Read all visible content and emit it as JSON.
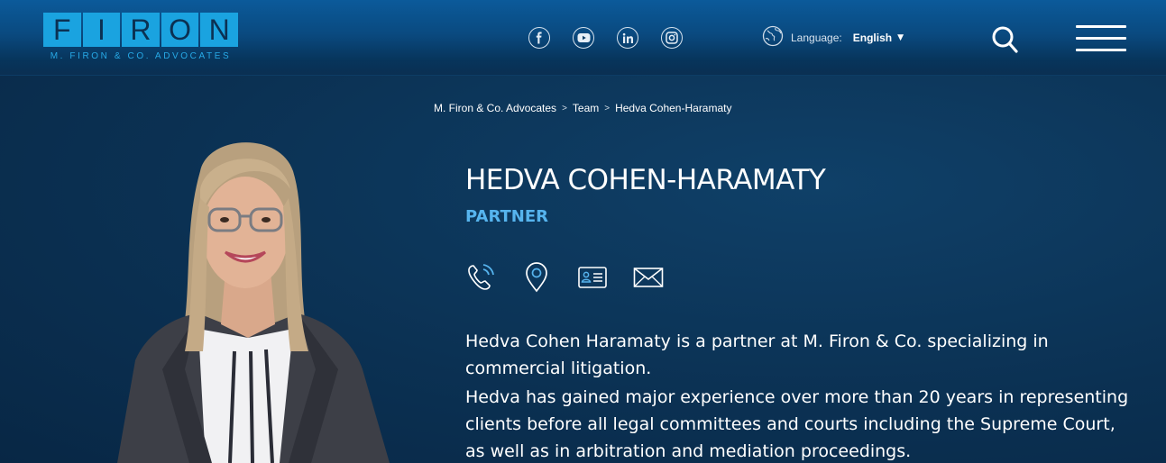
{
  "header": {
    "logo_letters": [
      "F",
      "I",
      "R",
      "O",
      "N"
    ],
    "logo_subtitle": "M. FIRON & CO. ADVOCATES",
    "socials": [
      {
        "icon": "facebook-icon",
        "glyph": "f"
      },
      {
        "icon": "youtube-icon",
        "glyph": "▶"
      },
      {
        "icon": "linkedin-icon",
        "glyph": "in"
      },
      {
        "icon": "instagram-icon",
        "glyph": "◎"
      }
    ],
    "language_label": "Language:",
    "language_value": "English",
    "search_icon": "search-icon",
    "menu_icon": "hamburger-menu-icon"
  },
  "breadcrumb": {
    "items": [
      "M. Firon & Co. Advocates",
      "Team",
      "Hedva Cohen-Haramaty"
    ],
    "separator": ">"
  },
  "profile": {
    "name": "HEDVA COHEN-HARAMATY",
    "role": "PARTNER",
    "contact_icons": [
      "phone-icon",
      "location-pin-icon",
      "vcard-icon",
      "email-icon"
    ],
    "bio": [
      "Hedva Cohen Haramaty is a partner at M. Firon & Co. specializing in commercial litigation.",
      "Hedva has gained major experience over more than 20 years in representing clients before all legal committees and courts including the Supreme Court, as well as in arbitration and mediation proceedings."
    ]
  },
  "colors": {
    "background": "#0b3153",
    "header_top": "#0b5a9a",
    "logo_blue": "#1aa3e0",
    "role_accent": "#56b4ee",
    "text": "#ffffff"
  }
}
